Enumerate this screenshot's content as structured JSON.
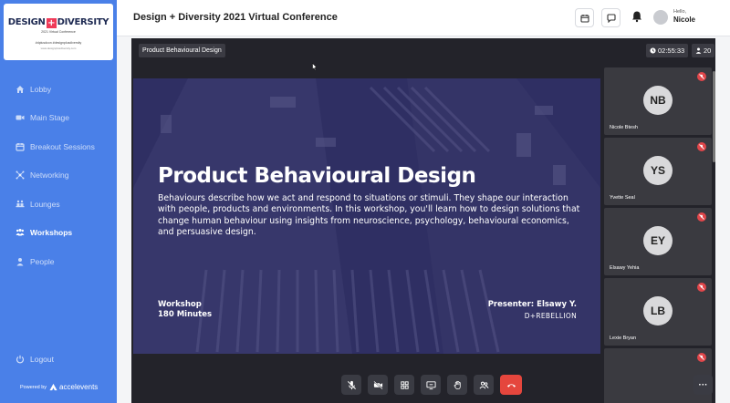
{
  "logo": {
    "title_left": "DESIGN",
    "title_plus": "+",
    "title_right": "DIVERSITY",
    "subtitle": "2021 Virtual Conference",
    "tags": "#dplusdcon #designplusdiversity",
    "url": "www.designplusdiversity.com"
  },
  "sidebar": {
    "items": [
      {
        "label": "Lobby",
        "icon": "home-icon"
      },
      {
        "label": "Main Stage",
        "icon": "video-camera-icon"
      },
      {
        "label": "Breakout Sessions",
        "icon": "calendar-icon"
      },
      {
        "label": "Networking",
        "icon": "network-icon"
      },
      {
        "label": "Lounges",
        "icon": "lounge-icon"
      },
      {
        "label": "Workshops",
        "icon": "people-group-icon"
      },
      {
        "label": "People",
        "icon": "person-icon"
      }
    ],
    "active": "Workshops",
    "logout_label": "Logout",
    "powered_by": "Powered by",
    "brand": "accelevents"
  },
  "header": {
    "title": "Design + Diversity 2021 Virtual Conference",
    "greeting": "Hello,",
    "user_name": "Nicole"
  },
  "stage": {
    "session_label": "Product Behavioural Design",
    "timer": "02:55:33",
    "attendee_count": "20"
  },
  "video": {
    "title": "Product Behavioural Design",
    "description": "Behaviours describe how we act and respond to situations or stimuli. They shape our interaction with people, products and environments. In this workshop, you'll learn how to design solutions that change human behaviour using insights from neuroscience, psychology, behavioural economics, and persuasive design.",
    "type_line1": "Workshop",
    "type_line2": "180 Minutes",
    "presenter": "Presenter: Elsawy Y.",
    "company": "D+REBELLION"
  },
  "participants": [
    {
      "initials": "NB",
      "name": "Nicole Btesh"
    },
    {
      "initials": "YS",
      "name": "Yvette Seal"
    },
    {
      "initials": "EY",
      "name": "Elsawy Yehia"
    },
    {
      "initials": "LB",
      "name": "Lexie Bryan"
    },
    {
      "initials": "",
      "name": ""
    }
  ],
  "controls": [
    "mic-off-icon",
    "camera-off-icon",
    "grid-icon",
    "screen-share-icon",
    "raise-hand-icon",
    "people-icon",
    "end-call-icon"
  ],
  "colors": {
    "sidebar": "#4a80e8",
    "end_call": "#e5463d",
    "mute_badge": "#e0464a"
  }
}
